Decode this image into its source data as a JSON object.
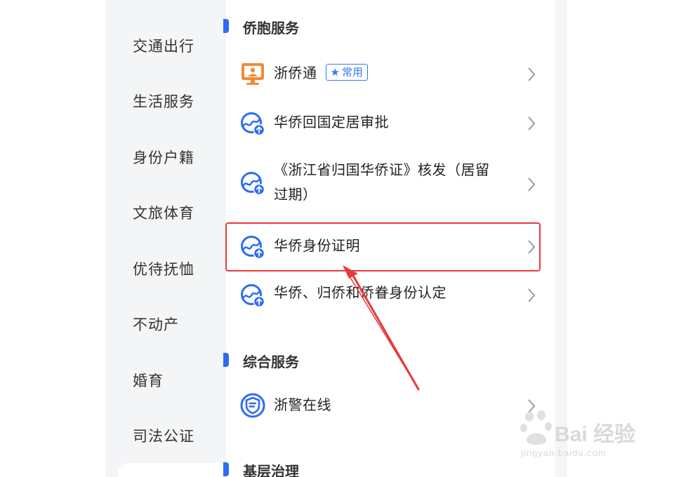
{
  "sidebar": {
    "items": [
      {
        "label": "交通出行"
      },
      {
        "label": "生活服务"
      },
      {
        "label": "身份户籍"
      },
      {
        "label": "文旅体育"
      },
      {
        "label": "优待抚恤"
      },
      {
        "label": "不动产"
      },
      {
        "label": "婚育"
      },
      {
        "label": "司法公证"
      }
    ]
  },
  "sections": [
    {
      "title": "侨胞服务",
      "items": [
        {
          "label": "浙侨通",
          "badge": "常用",
          "icon": "person-monitor-icon"
        },
        {
          "label": "华侨回国定居审批",
          "icon": "globe-upload-icon"
        },
        {
          "label_line1": "《浙江省归国华侨证》核发（居留",
          "label_line2": "过期）",
          "icon": "globe-upload-icon"
        },
        {
          "label": "华侨身份证明",
          "icon": "globe-upload-icon"
        },
        {
          "label": "华侨、归侨和侨眷身份认定",
          "icon": "globe-upload-icon"
        }
      ]
    },
    {
      "title": "综合服务",
      "items": [
        {
          "label": "浙警在线",
          "icon": "police-shield-icon"
        }
      ]
    },
    {
      "title": "基层治理",
      "items": []
    }
  ],
  "colors": {
    "accent": "#2f6bf3",
    "highlight": "#e83a3a",
    "icon_orange": "#f08a3c"
  },
  "watermark": {
    "text": "Bai 经验",
    "sub": "jingyan.baidu.com"
  }
}
